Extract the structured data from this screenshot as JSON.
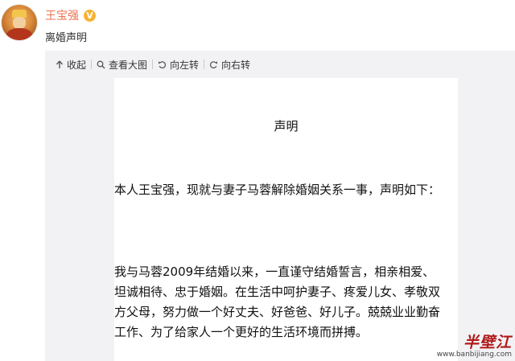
{
  "post": {
    "username": "王宝强",
    "verified_badge": "V",
    "text": "离婚声明"
  },
  "toolbar": {
    "collapse_label": "收起",
    "view_large_label": "查看大图",
    "rotate_left_label": "向左转",
    "rotate_right_label": "向右转"
  },
  "image_content": {
    "title": "声明",
    "paragraph1": "本人王宝强，现就与妻子马蓉解除婚姻关系一事，声明如下：",
    "paragraph2": "我与马蓉2009年结婚以来，一直谨守结婚誓言，相亲相爱、坦诚相待、忠于婚姻。在生活中呵护妻子、疼爱儿女、孝敬双方父母，努力做一个好丈夫、好爸爸、好儿子。兢兢业业勤奋工作、为了给家人一个更好的生活环境而拼搏。"
  },
  "watermark": {
    "title": "半壁江",
    "url": "www.banbijiang.com"
  },
  "colors": {
    "username": "#eb7350",
    "badge": "#f4b233",
    "toolbar_bg": "#f2f2f5",
    "watermark": "#b01919"
  },
  "icons": [
    "collapse-arrow-icon",
    "magnifier-icon",
    "rotate-left-icon",
    "rotate-right-icon"
  ]
}
